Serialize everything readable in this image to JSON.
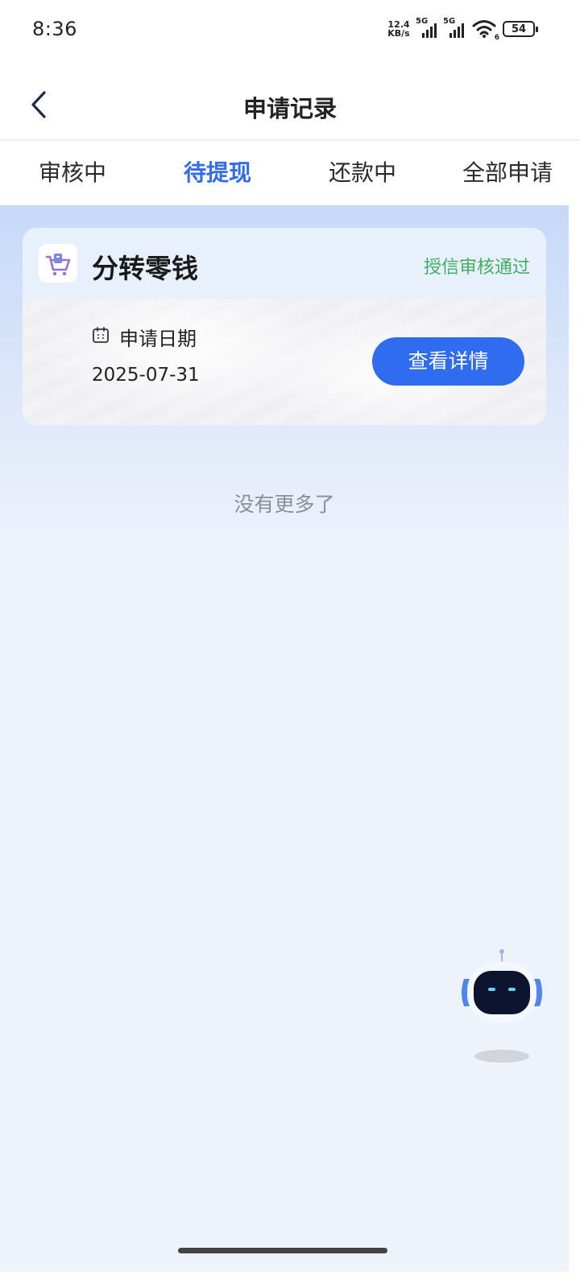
{
  "status_bar": {
    "time": "8:36",
    "net_speed_value": "12.4",
    "net_speed_unit": "KB/s",
    "sim1_label": "5G",
    "sim2_label": "5G",
    "wifi_label": "6",
    "battery": "54"
  },
  "header": {
    "title": "申请记录"
  },
  "tabs": [
    {
      "label": "审核中",
      "active": false
    },
    {
      "label": "待提现",
      "active": true
    },
    {
      "label": "还款中",
      "active": false
    },
    {
      "label": "全部申请",
      "active": false
    }
  ],
  "records": [
    {
      "app_name": "分转零钱",
      "status": "授信审核通过",
      "date_label": "申请日期",
      "date_value": "2025-07-31",
      "action_label": "查看详情"
    }
  ],
  "list_footer": "没有更多了",
  "colors": {
    "accent": "#2f6cf0",
    "status_green": "#3fae63"
  }
}
